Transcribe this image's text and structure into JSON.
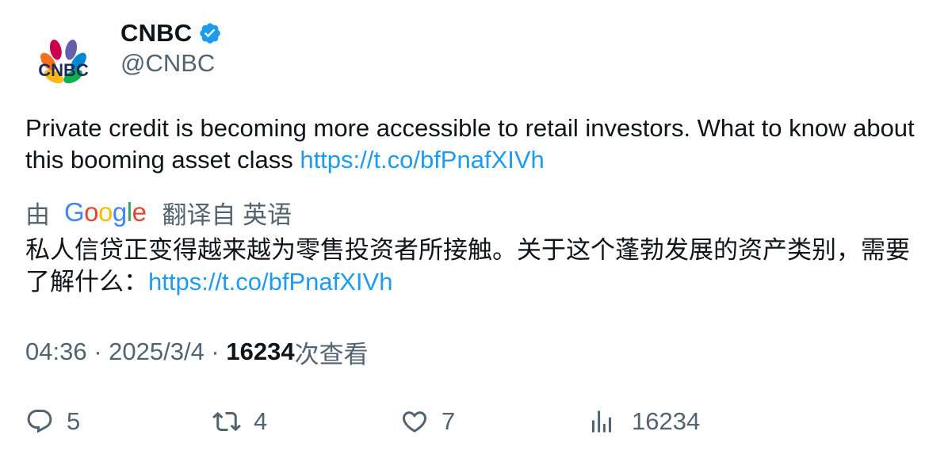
{
  "author": {
    "display_name": "CNBC",
    "handle": "@CNBC",
    "logo_text": "CNBC",
    "avatar_icon": "cnbc-peacock-logo",
    "verified_icon": "verified-badge-icon",
    "verified_color": "#1d9bf0"
  },
  "tweet": {
    "text": "Private credit is becoming more accessible to retail investors. What to know about this booming asset class ",
    "link": "https://t.co/bfPnafXIVh"
  },
  "translation": {
    "prefix": "由",
    "provider": "Google",
    "suffix": "翻译自 英语",
    "text": "私人信贷正变得越来越为零售投资者所接触。关于这个蓬勃发展的资产类别，需要了解什么：",
    "link": "https://t.co/bfPnafXIVh"
  },
  "meta": {
    "time": "04:36",
    "separator": " · ",
    "date": "2025/3/4",
    "views": "16234",
    "views_label": "次查看"
  },
  "actions": {
    "reply_count": "5",
    "retweet_count": "4",
    "like_count": "7",
    "views_count": "16234"
  },
  "colors": {
    "link": "#1d9bf0",
    "secondary_text": "#536471",
    "primary_text": "#0f1419",
    "google_blue": "#4285F4",
    "google_red": "#EA4335",
    "google_yellow": "#FBBC05",
    "google_green": "#34A853"
  }
}
